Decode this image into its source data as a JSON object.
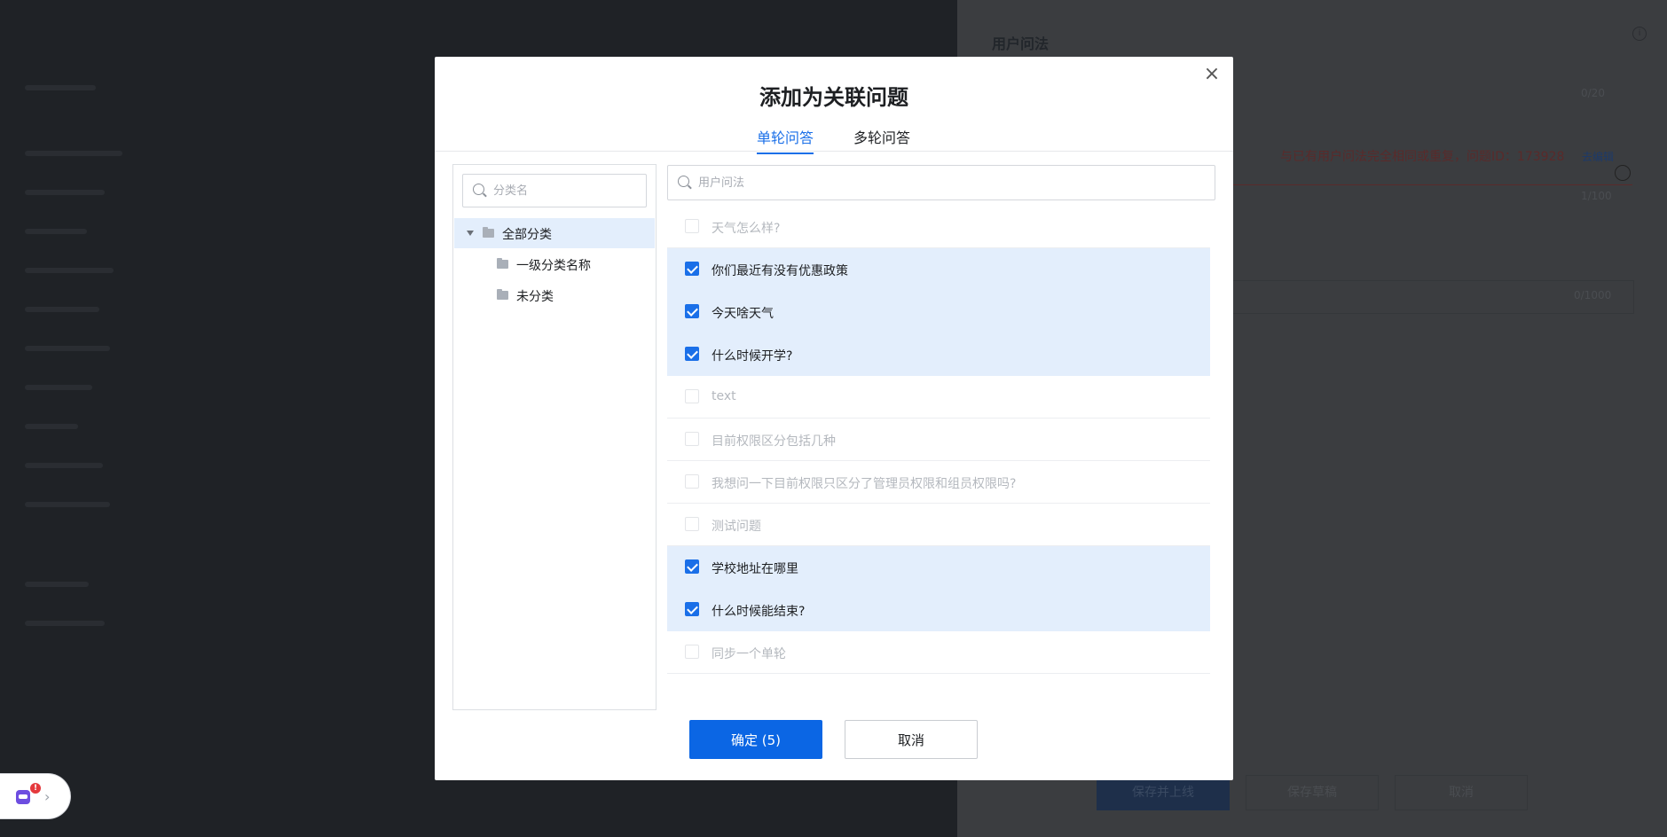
{
  "background": {
    "title": "用户问法",
    "counter_top": "0/20",
    "counter_mid": "1/100",
    "counter_bottom": "0/1000",
    "duplicate_warning": "与已有用户问法完全相同或重复，问题ID：173928",
    "edit_link": "去编辑",
    "buttons": [
      "保存并上线",
      "保存草稿",
      "取消"
    ]
  },
  "modal": {
    "title": "添加为关联问题",
    "close_icon": "×",
    "tabs": [
      {
        "label": "单轮问答",
        "active": true
      },
      {
        "label": "多轮问答",
        "active": false
      }
    ],
    "category_search_placeholder": "分类名",
    "question_search_placeholder": "用户问法",
    "categories": [
      {
        "label": "全部分类",
        "selected": true,
        "expanded": true
      },
      {
        "label": "一级分类名称",
        "selected": false
      },
      {
        "label": "未分类",
        "selected": false
      }
    ],
    "questions": [
      {
        "text": "天气怎么样?",
        "checked": false
      },
      {
        "text": "你们最近有没有优惠政策",
        "checked": true
      },
      {
        "text": "今天啥天气",
        "checked": true
      },
      {
        "text": "什么时候开学?",
        "checked": true
      },
      {
        "text": "text",
        "checked": false
      },
      {
        "text": "目前权限区分包括几种",
        "checked": false
      },
      {
        "text": "我想问一下目前权限只区分了管理员权限和组员权限吗?",
        "checked": false
      },
      {
        "text": "测试问题",
        "checked": false
      },
      {
        "text": "学校地址在哪里",
        "checked": true
      },
      {
        "text": "什么时候能结束?",
        "checked": true
      },
      {
        "text": "同步一个单轮",
        "checked": false
      }
    ],
    "confirm_label": "确定 (5)",
    "cancel_label": "取消"
  },
  "assistant": {
    "badge": "!",
    "arrow": "›"
  },
  "colors": {
    "accent": "#1a6fe8",
    "primary_button": "#0b66e4",
    "selected_bg": "#e3eefc"
  }
}
